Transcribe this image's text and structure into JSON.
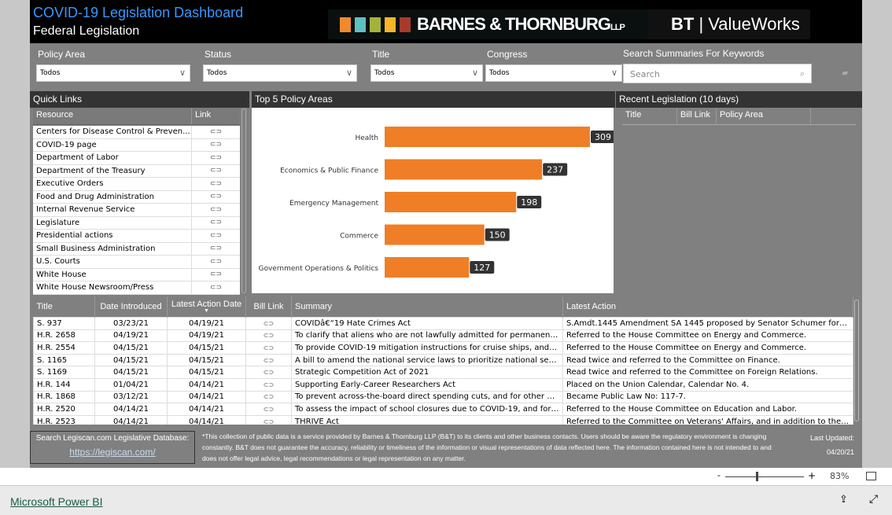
{
  "header": {
    "title": "COVID-19 Legislation Dashboard",
    "subtitle": "Federal Legislation",
    "logo_text": "BARNES & THORNBURG LLP",
    "logo2_text": "BT ValueWorks",
    "logo_colors": [
      "#f08a2c",
      "#5fc0c0",
      "#a4b23a",
      "#f6b42b",
      "#a83a2c"
    ]
  },
  "filters": [
    {
      "label": "Policy Area",
      "value": "Todos"
    },
    {
      "label": "Status",
      "value": "Todos"
    },
    {
      "label": "Title",
      "value": "Todos"
    },
    {
      "label": "Congress",
      "value": "Todos"
    }
  ],
  "search": {
    "label": "Search Summaries For Keywords",
    "placeholder": "Search"
  },
  "quick_links": {
    "title": "Quick Links",
    "col_resource": "Resource",
    "col_link": "Link",
    "items": [
      "Centers for Disease Control & Preven...",
      "COVID-19 page",
      "Department of Labor",
      "Department of the Treasury",
      "Executive Orders",
      "Food and Drug Administration",
      "Internal Revenue Service",
      "Legislature",
      "Presidential actions",
      "Small Business Administration",
      "U.S. Courts",
      "White House",
      "White House Newsroom/Press"
    ]
  },
  "chart_data": {
    "type": "bar",
    "orientation": "horizontal",
    "title": "Top 5 Policy Areas",
    "categories": [
      "Health",
      "Economics & Public Finance",
      "Emergency Management",
      "Commerce",
      "Government Operations & Politics"
    ],
    "values": [
      309,
      237,
      198,
      150,
      127
    ],
    "color": "#f07e26"
  },
  "recent": {
    "title": "Recent Legislation (10 days)",
    "columns": [
      "Title",
      "Bill Link",
      "Policy Area"
    ]
  },
  "main_table": {
    "columns": [
      "Title",
      "Date Introduced",
      "Latest Action Date",
      "Bill Link",
      "Summary",
      "Latest Action"
    ],
    "rows": [
      [
        "S. 937",
        "03/23/21",
        "04/19/21",
        "COVIDâ€“19 Hate Crimes Act",
        "S.Amdt.1445 Amendment SA 1445 proposed by Senator Schumer for S..."
      ],
      [
        "H.R. 2658",
        "04/19/21",
        "04/19/21",
        "To clarify that aliens who are not lawfully admitted for permanent ...",
        "Referred to the House Committee on Energy and Commerce."
      ],
      [
        "H.R. 2554",
        "04/15/21",
        "04/15/21",
        "To provide COVID-19 mitigation instructions for cruise ships, and o...",
        "Referred to the House Committee on Energy and Commerce."
      ],
      [
        "S. 1165",
        "04/15/21",
        "04/15/21",
        "A bill to amend the national service laws to prioritize national serv...",
        "Read twice and referred to the Committee on Finance."
      ],
      [
        "S. 1169",
        "04/15/21",
        "04/15/21",
        "Strategic Competition Act of 2021",
        "Read twice and referred to the Committee on Foreign Relations."
      ],
      [
        "H.R. 144",
        "01/04/21",
        "04/14/21",
        "Supporting Early-Career Researchers Act",
        "Placed on the Union Calendar, Calendar No. 4."
      ],
      [
        "H.R. 1868",
        "03/12/21",
        "04/14/21",
        "To prevent across-the-board direct spending cuts, and for other p...",
        "Became Public Law No: 117-7."
      ],
      [
        "H.R. 2520",
        "04/14/21",
        "04/14/21",
        "To assess the impact of school closures due to COVID-19, and for o...",
        "Referred to the House Committee on Education and Labor."
      ],
      [
        "H.R. 2523",
        "04/14/21",
        "04/14/21",
        "THRIVE Act",
        "Referred to the Committee on Veterans' Affairs, and in addition to the C..."
      ]
    ]
  },
  "footer": {
    "legiscan_label": "Search Legiscan.com Legislative Database:",
    "legiscan_link": "https://legiscan.com/",
    "disclaimer": "*This collection of public data is a service provided by Barnes & Thornburg LLP (B&T) to its clients and other business contacts.  Users should be aware the regulatory environment is changing constantly.  B&T does not guarantee the accuracy, reliability or timeliness of the information or visual representations of data reflected here.  The information contained here is not intended to and does not offer legal advice, legal recommendations or legal representation on any matter.",
    "updated_label": "Last Updated:",
    "updated_value": "04/20/21"
  },
  "zoom": {
    "level": "83%",
    "minus": "-",
    "plus": "+"
  },
  "bottom": {
    "brand": "Microsoft Power BI"
  }
}
